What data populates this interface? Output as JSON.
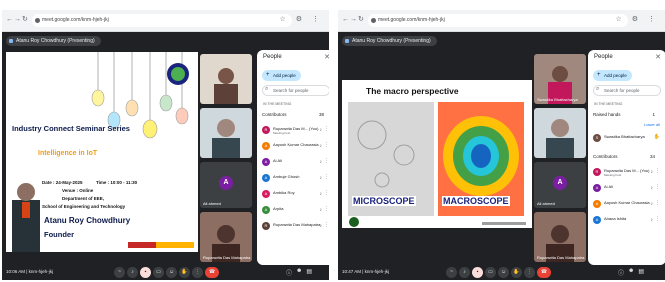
{
  "browser": {
    "url": "meet.google.com/knm-hjeh-jkj",
    "nav_back": "←",
    "nav_fwd": "→",
    "nav_reload": "↻"
  },
  "left": {
    "presenter_label": "Atanu Roy Chowdhury (Presenting)",
    "slide": {
      "title": "Industry Connect Seminar Series",
      "subtitle": "Intelligence in IoT",
      "date_line": "Date : 24-May-2025",
      "time_line": "Time : 10:00 - 11:30",
      "venue_line": "Venue : Online",
      "dept_line": "Department of EEE,",
      "school_line": "School of Engineering and Technology",
      "speaker": "Atanu Roy Chowdhury",
      "role": "Founder"
    },
    "tiles": [
      {
        "name": ""
      },
      {
        "name": ""
      },
      {
        "name": "Ali ahmed",
        "initial": "A",
        "color": "#7b1fa2"
      },
      {
        "name": "Rupanwita Das Mahapatra"
      }
    ],
    "bottom_time": "10:06 AM | knm-hjeh-jkj",
    "people": {
      "title": "People",
      "add_label": "Add people",
      "search_placeholder": "Search for people",
      "in_meeting": "IN THE MEETING",
      "group_label": "Contributors",
      "group_count": "38",
      "rows": [
        {
          "name": "Rupanwita Das M... (You)",
          "sub": "Meeting host",
          "initial": "R",
          "color": "#c2185b"
        },
        {
          "name": "Aayush Kumar Chaurasia",
          "sub": "",
          "initial": "A",
          "color": "#f57c00"
        },
        {
          "name": "Ai Ali",
          "sub": "",
          "initial": "A",
          "color": "#7b1fa2"
        },
        {
          "name": "Ambuje Ghosh",
          "sub": "",
          "initial": "A",
          "color": "#1976d2"
        },
        {
          "name": "Ambika Roy",
          "sub": "",
          "initial": "A",
          "color": "#d81b60"
        },
        {
          "name": "Arpita",
          "sub": "",
          "initial": "A",
          "color": "#388e3c"
        },
        {
          "name": "Rupanwita Das Mahapatra",
          "sub": "",
          "initial": "R",
          "color": "#5d4037"
        }
      ]
    }
  },
  "right": {
    "presenter_label": "Atanu Roy Chowdhury (Presenting)",
    "slide": {
      "title": "The macro perspective",
      "microscope_label": "MICROSCOPE",
      "macroscope_label": "MACROSCOPE"
    },
    "tiles": [
      {
        "name": "Swastika Bhattacharya"
      },
      {
        "name": ""
      },
      {
        "name": "Ali ahmed",
        "initial": "A",
        "color": "#7b1fa2"
      },
      {
        "name": "Rupanwita Das Mahapatra"
      }
    ],
    "bottom_time": "10:47 AM | knm-hjeh-jkj",
    "people": {
      "title": "People",
      "add_label": "Add people",
      "search_placeholder": "Search for people",
      "in_meeting": "IN THE MEETING",
      "raised_label": "Raised hands",
      "raised_count": "1",
      "lower_all": "Lower all",
      "raised_rows": [
        {
          "name": "Swastika Bhattacharya",
          "sub": "",
          "initial": "S",
          "color": "#6d4c41"
        }
      ],
      "group_label": "Contributors",
      "group_count": "34",
      "rows": [
        {
          "name": "Rupanwita Das M... (You)",
          "sub": "Meeting host",
          "initial": "R",
          "color": "#c2185b"
        },
        {
          "name": "Ai Ali",
          "sub": "",
          "initial": "A",
          "color": "#7b1fa2"
        },
        {
          "name": "Aayush Kumar Chaurasia",
          "sub": "",
          "initial": "A",
          "color": "#f57c00"
        },
        {
          "name": "Ahana Ishita",
          "sub": "",
          "initial": "A",
          "color": "#1976d2"
        }
      ]
    }
  }
}
